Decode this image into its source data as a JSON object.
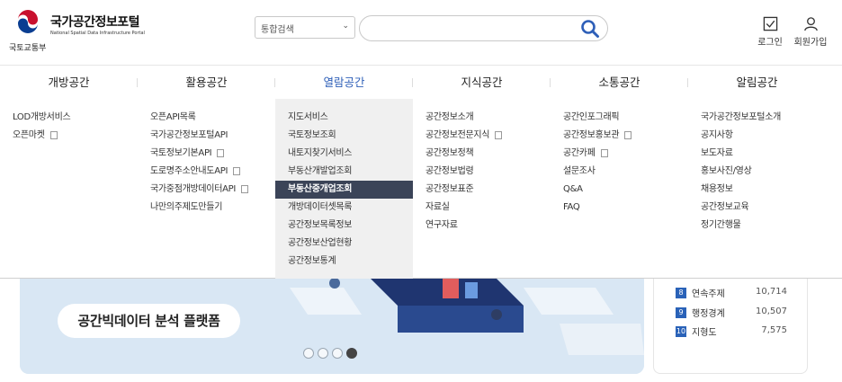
{
  "header": {
    "org_label": "국토교통부",
    "site_title": "국가공간정보포털",
    "site_subtitle": "National Spatial Data Infrastructure Portal",
    "search_select": "통합검색",
    "search_placeholder": "",
    "login_label": "로그인",
    "join_label": "회원가입"
  },
  "gnb": [
    {
      "label": "개방공간"
    },
    {
      "label": "활용공간"
    },
    {
      "label": "열람공간"
    },
    {
      "label": "지식공간"
    },
    {
      "label": "소통공간"
    },
    {
      "label": "알림공간"
    }
  ],
  "mega": [
    {
      "items": [
        {
          "label": "LOD개방서비스",
          "copy": false
        },
        {
          "label": "오픈마켓",
          "copy": true
        }
      ]
    },
    {
      "items": [
        {
          "label": "오픈API목록",
          "copy": false
        },
        {
          "label": "국가공간정보포털API",
          "copy": false
        },
        {
          "label": "국토정보기본API",
          "copy": true
        },
        {
          "label": "도로명주소안내도API",
          "copy": true
        },
        {
          "label": "국가중점개방데이터API",
          "copy": true
        },
        {
          "label": "나만의주제도만들기",
          "copy": false
        }
      ]
    },
    {
      "items": [
        {
          "label": "지도서비스",
          "copy": false
        },
        {
          "label": "국토정보조회",
          "copy": false
        },
        {
          "label": "내토지찾기서비스",
          "copy": false
        },
        {
          "label": "부동산개발업조회",
          "copy": false
        },
        {
          "label": "부동산중개업조회",
          "copy": false,
          "highlight": true
        },
        {
          "label": "개방데이터셋목록",
          "copy": false
        },
        {
          "label": "공간정보목록정보",
          "copy": false
        },
        {
          "label": "공간정보산업현황",
          "copy": false
        },
        {
          "label": "공간정보통계",
          "copy": false
        }
      ]
    },
    {
      "items": [
        {
          "label": "공간정보소개",
          "copy": false
        },
        {
          "label": "공간정보전문지식",
          "copy": true
        },
        {
          "label": "공간정보정책",
          "copy": false
        },
        {
          "label": "공간정보법령",
          "copy": false
        },
        {
          "label": "공간정보표준",
          "copy": false
        },
        {
          "label": "자료실",
          "copy": false
        },
        {
          "label": "연구자료",
          "copy": false
        }
      ]
    },
    {
      "items": [
        {
          "label": "공간인포그래픽",
          "copy": false
        },
        {
          "label": "공간정보홍보관",
          "copy": true
        },
        {
          "label": "공간카페",
          "copy": true
        },
        {
          "label": "설문조사",
          "copy": false
        },
        {
          "label": "Q&A",
          "copy": false
        },
        {
          "label": "FAQ",
          "copy": false
        }
      ]
    },
    {
      "items": [
        {
          "label": "국가공간정보포털소개",
          "copy": false
        },
        {
          "label": "공지사항",
          "copy": false
        },
        {
          "label": "보도자료",
          "copy": false
        },
        {
          "label": "홍보사진/영상",
          "copy": false
        },
        {
          "label": "채용정보",
          "copy": false
        },
        {
          "label": "공간정보교육",
          "copy": false
        },
        {
          "label": "정기간행물",
          "copy": false
        }
      ]
    }
  ],
  "hero": {
    "caption": "공간빅데이터 분석 플랫폼",
    "slide_count": 4,
    "active_slide": 4
  },
  "ranking": [
    {
      "num": "8",
      "name": "연속주제",
      "value": "10,714"
    },
    {
      "num": "9",
      "name": "행정경계",
      "value": "10,507"
    },
    {
      "num": "10",
      "name": "지형도",
      "value": "7,575"
    }
  ],
  "colors": {
    "accent": "#2e5fb8",
    "highlight_bg": "#3b4458",
    "rank_badge": "#2a62b8"
  }
}
